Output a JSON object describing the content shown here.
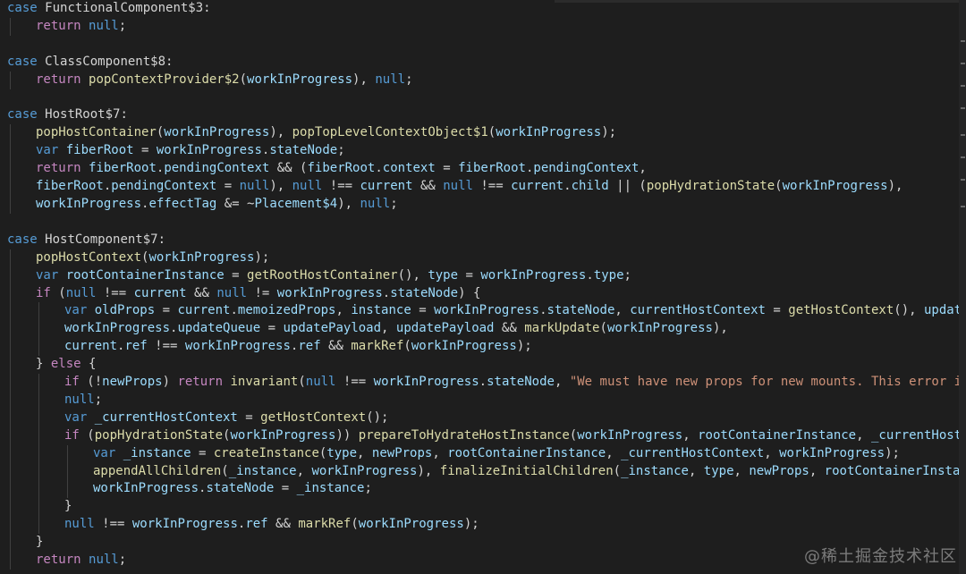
{
  "editor": {
    "theme": {
      "background": "#1e1e1e",
      "keyword": "#569cd6",
      "control": "#c586c0",
      "function": "#dcdcaa",
      "variable": "#9cdcfe",
      "string": "#ce9178",
      "plain": "#d4d4d4"
    },
    "lines": [
      {
        "indent": 0,
        "tokens": [
          [
            "keyword",
            "case "
          ],
          [
            "plain",
            "FunctionalComponent$3:"
          ]
        ]
      },
      {
        "indent": 1,
        "tokens": [
          [
            "control",
            "return "
          ],
          [
            "keyword",
            "null"
          ],
          [
            "plain",
            ";"
          ]
        ]
      },
      {
        "indent": 0,
        "tokens": []
      },
      {
        "indent": 0,
        "tokens": [
          [
            "keyword",
            "case "
          ],
          [
            "plain",
            "ClassComponent$8:"
          ]
        ]
      },
      {
        "indent": 1,
        "tokens": [
          [
            "control",
            "return "
          ],
          [
            "func",
            "popContextProvider$2"
          ],
          [
            "plain",
            "("
          ],
          [
            "var",
            "workInProgress"
          ],
          [
            "plain",
            "), "
          ],
          [
            "keyword",
            "null"
          ],
          [
            "plain",
            ";"
          ]
        ]
      },
      {
        "indent": 0,
        "tokens": []
      },
      {
        "indent": 0,
        "tokens": [
          [
            "keyword",
            "case "
          ],
          [
            "plain",
            "HostRoot$7:"
          ]
        ]
      },
      {
        "indent": 1,
        "tokens": [
          [
            "func",
            "popHostContainer"
          ],
          [
            "plain",
            "("
          ],
          [
            "var",
            "workInProgress"
          ],
          [
            "plain",
            "), "
          ],
          [
            "func",
            "popTopLevelContextObject$1"
          ],
          [
            "plain",
            "("
          ],
          [
            "var",
            "workInProgress"
          ],
          [
            "plain",
            ");"
          ]
        ]
      },
      {
        "indent": 1,
        "tokens": [
          [
            "keyword",
            "var "
          ],
          [
            "var",
            "fiberRoot"
          ],
          [
            "plain",
            " = "
          ],
          [
            "var",
            "workInProgress"
          ],
          [
            "plain",
            "."
          ],
          [
            "var",
            "stateNode"
          ],
          [
            "plain",
            ";"
          ]
        ]
      },
      {
        "indent": 1,
        "tokens": [
          [
            "control",
            "return "
          ],
          [
            "var",
            "fiberRoot"
          ],
          [
            "plain",
            "."
          ],
          [
            "var",
            "pendingContext"
          ],
          [
            "plain",
            " && ("
          ],
          [
            "var",
            "fiberRoot"
          ],
          [
            "plain",
            "."
          ],
          [
            "var",
            "context"
          ],
          [
            "plain",
            " = "
          ],
          [
            "var",
            "fiberRoot"
          ],
          [
            "plain",
            "."
          ],
          [
            "var",
            "pendingContext"
          ],
          [
            "plain",
            ","
          ]
        ]
      },
      {
        "indent": 1,
        "tokens": [
          [
            "var",
            "fiberRoot"
          ],
          [
            "plain",
            "."
          ],
          [
            "var",
            "pendingContext"
          ],
          [
            "plain",
            " = "
          ],
          [
            "keyword",
            "null"
          ],
          [
            "plain",
            "), "
          ],
          [
            "keyword",
            "null"
          ],
          [
            "plain",
            " !== "
          ],
          [
            "var",
            "current"
          ],
          [
            "plain",
            " && "
          ],
          [
            "keyword",
            "null"
          ],
          [
            "plain",
            " !== "
          ],
          [
            "var",
            "current"
          ],
          [
            "plain",
            "."
          ],
          [
            "var",
            "child"
          ],
          [
            "plain",
            " || ("
          ],
          [
            "func",
            "popHydrationState"
          ],
          [
            "plain",
            "("
          ],
          [
            "var",
            "workInProgress"
          ],
          [
            "plain",
            "),"
          ]
        ]
      },
      {
        "indent": 1,
        "tokens": [
          [
            "var",
            "workInProgress"
          ],
          [
            "plain",
            "."
          ],
          [
            "var",
            "effectTag"
          ],
          [
            "plain",
            " &= ~"
          ],
          [
            "var",
            "Placement$4"
          ],
          [
            "plain",
            "), "
          ],
          [
            "keyword",
            "null"
          ],
          [
            "plain",
            ";"
          ]
        ]
      },
      {
        "indent": 0,
        "tokens": []
      },
      {
        "indent": 0,
        "tokens": [
          [
            "keyword",
            "case "
          ],
          [
            "plain",
            "HostComponent$7:"
          ]
        ]
      },
      {
        "indent": 1,
        "tokens": [
          [
            "func",
            "popHostContext"
          ],
          [
            "plain",
            "("
          ],
          [
            "var",
            "workInProgress"
          ],
          [
            "plain",
            ");"
          ]
        ]
      },
      {
        "indent": 1,
        "tokens": [
          [
            "keyword",
            "var "
          ],
          [
            "var",
            "rootContainerInstance"
          ],
          [
            "plain",
            " = "
          ],
          [
            "func",
            "getRootHostContainer"
          ],
          [
            "plain",
            "(), "
          ],
          [
            "var",
            "type"
          ],
          [
            "plain",
            " = "
          ],
          [
            "var",
            "workInProgress"
          ],
          [
            "plain",
            "."
          ],
          [
            "var",
            "type"
          ],
          [
            "plain",
            ";"
          ]
        ]
      },
      {
        "indent": 1,
        "tokens": [
          [
            "control",
            "if "
          ],
          [
            "plain",
            "("
          ],
          [
            "keyword",
            "null"
          ],
          [
            "plain",
            " !== "
          ],
          [
            "var",
            "current"
          ],
          [
            "plain",
            " && "
          ],
          [
            "keyword",
            "null"
          ],
          [
            "plain",
            " != "
          ],
          [
            "var",
            "workInProgress"
          ],
          [
            "plain",
            "."
          ],
          [
            "var",
            "stateNode"
          ],
          [
            "plain",
            ") {"
          ]
        ]
      },
      {
        "indent": 2,
        "tokens": [
          [
            "keyword",
            "var "
          ],
          [
            "var",
            "oldProps"
          ],
          [
            "plain",
            " = "
          ],
          [
            "var",
            "current"
          ],
          [
            "plain",
            "."
          ],
          [
            "var",
            "memoizedProps"
          ],
          [
            "plain",
            ", "
          ],
          [
            "var",
            "instance"
          ],
          [
            "plain",
            " = "
          ],
          [
            "var",
            "workInProgress"
          ],
          [
            "plain",
            "."
          ],
          [
            "var",
            "stateNode"
          ],
          [
            "plain",
            ", "
          ],
          [
            "var",
            "currentHostContext"
          ],
          [
            "plain",
            " = "
          ],
          [
            "func",
            "getHostContext"
          ],
          [
            "plain",
            "(), "
          ],
          [
            "var",
            "updatePayloa"
          ]
        ]
      },
      {
        "indent": 2,
        "tokens": [
          [
            "var",
            "workInProgress"
          ],
          [
            "plain",
            "."
          ],
          [
            "var",
            "updateQueue"
          ],
          [
            "plain",
            " = "
          ],
          [
            "var",
            "updatePayload"
          ],
          [
            "plain",
            ", "
          ],
          [
            "var",
            "updatePayload"
          ],
          [
            "plain",
            " && "
          ],
          [
            "func",
            "markUpdate"
          ],
          [
            "plain",
            "("
          ],
          [
            "var",
            "workInProgress"
          ],
          [
            "plain",
            "),"
          ]
        ]
      },
      {
        "indent": 2,
        "tokens": [
          [
            "var",
            "current"
          ],
          [
            "plain",
            "."
          ],
          [
            "var",
            "ref"
          ],
          [
            "plain",
            " !== "
          ],
          [
            "var",
            "workInProgress"
          ],
          [
            "plain",
            "."
          ],
          [
            "var",
            "ref"
          ],
          [
            "plain",
            " && "
          ],
          [
            "func",
            "markRef"
          ],
          [
            "plain",
            "("
          ],
          [
            "var",
            "workInProgress"
          ],
          [
            "plain",
            ");"
          ]
        ]
      },
      {
        "indent": 1,
        "tokens": [
          [
            "plain",
            "} "
          ],
          [
            "control",
            "else "
          ],
          [
            "plain",
            "{"
          ]
        ]
      },
      {
        "indent": 2,
        "tokens": [
          [
            "control",
            "if "
          ],
          [
            "plain",
            "(!"
          ],
          [
            "var",
            "newProps"
          ],
          [
            "plain",
            ") "
          ],
          [
            "control",
            "return "
          ],
          [
            "func",
            "invariant"
          ],
          [
            "plain",
            "("
          ],
          [
            "keyword",
            "null"
          ],
          [
            "plain",
            " !== "
          ],
          [
            "var",
            "workInProgress"
          ],
          [
            "plain",
            "."
          ],
          [
            "var",
            "stateNode"
          ],
          [
            "plain",
            ", "
          ],
          [
            "string",
            "\"We must have new props for new mounts. This error is likel"
          ]
        ]
      },
      {
        "indent": 2,
        "tokens": [
          [
            "keyword",
            "null"
          ],
          [
            "plain",
            ";"
          ]
        ]
      },
      {
        "indent": 2,
        "tokens": [
          [
            "keyword",
            "var "
          ],
          [
            "var",
            "_currentHostContext"
          ],
          [
            "plain",
            " = "
          ],
          [
            "func",
            "getHostContext"
          ],
          [
            "plain",
            "();"
          ]
        ]
      },
      {
        "indent": 2,
        "tokens": [
          [
            "control",
            "if "
          ],
          [
            "plain",
            "("
          ],
          [
            "func",
            "popHydrationState"
          ],
          [
            "plain",
            "("
          ],
          [
            "var",
            "workInProgress"
          ],
          [
            "plain",
            ")) "
          ],
          [
            "func",
            "prepareToHydrateHostInstance"
          ],
          [
            "plain",
            "("
          ],
          [
            "var",
            "workInProgress"
          ],
          [
            "plain",
            ", "
          ],
          [
            "var",
            "rootContainerInstance"
          ],
          [
            "plain",
            ", "
          ],
          [
            "var",
            "_currentHostContext"
          ]
        ]
      },
      {
        "indent": 3,
        "tokens": [
          [
            "keyword",
            "var "
          ],
          [
            "var",
            "_instance"
          ],
          [
            "plain",
            " = "
          ],
          [
            "func",
            "createInstance"
          ],
          [
            "plain",
            "("
          ],
          [
            "var",
            "type"
          ],
          [
            "plain",
            ", "
          ],
          [
            "var",
            "newProps"
          ],
          [
            "plain",
            ", "
          ],
          [
            "var",
            "rootContainerInstance"
          ],
          [
            "plain",
            ", "
          ],
          [
            "var",
            "_currentHostContext"
          ],
          [
            "plain",
            ", "
          ],
          [
            "var",
            "workInProgress"
          ],
          [
            "plain",
            ");"
          ]
        ]
      },
      {
        "indent": 3,
        "tokens": [
          [
            "func",
            "appendAllChildren"
          ],
          [
            "plain",
            "("
          ],
          [
            "var",
            "_instance"
          ],
          [
            "plain",
            ", "
          ],
          [
            "var",
            "workInProgress"
          ],
          [
            "plain",
            "), "
          ],
          [
            "func",
            "finalizeInitialChildren"
          ],
          [
            "plain",
            "("
          ],
          [
            "var",
            "_instance"
          ],
          [
            "plain",
            ", "
          ],
          [
            "var",
            "type"
          ],
          [
            "plain",
            ", "
          ],
          [
            "var",
            "newProps"
          ],
          [
            "plain",
            ", "
          ],
          [
            "var",
            "rootContainerInstance"
          ],
          [
            "plain",
            ") &&"
          ]
        ]
      },
      {
        "indent": 3,
        "tokens": [
          [
            "var",
            "workInProgress"
          ],
          [
            "plain",
            "."
          ],
          [
            "var",
            "stateNode"
          ],
          [
            "plain",
            " = "
          ],
          [
            "var",
            "_instance"
          ],
          [
            "plain",
            ";"
          ]
        ]
      },
      {
        "indent": 2,
        "tokens": [
          [
            "plain",
            "}"
          ]
        ]
      },
      {
        "indent": 2,
        "tokens": [
          [
            "keyword",
            "null"
          ],
          [
            "plain",
            " !== "
          ],
          [
            "var",
            "workInProgress"
          ],
          [
            "plain",
            "."
          ],
          [
            "var",
            "ref"
          ],
          [
            "plain",
            " && "
          ],
          [
            "func",
            "markRef"
          ],
          [
            "plain",
            "("
          ],
          [
            "var",
            "workInProgress"
          ],
          [
            "plain",
            ");"
          ]
        ]
      },
      {
        "indent": 1,
        "tokens": [
          [
            "plain",
            "}"
          ]
        ]
      },
      {
        "indent": 1,
        "tokens": [
          [
            "control",
            "return "
          ],
          [
            "keyword",
            "null"
          ],
          [
            "plain",
            ";"
          ]
        ]
      }
    ]
  },
  "watermark": "@稀土掘金技术社区"
}
